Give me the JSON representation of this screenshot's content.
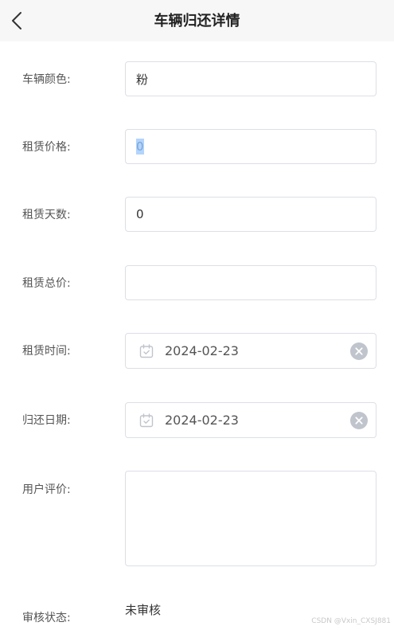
{
  "header": {
    "title": "车辆归还详情",
    "back_icon": "chevron-left-icon"
  },
  "form": {
    "color": {
      "label": "车辆颜色:",
      "value": "粉"
    },
    "price": {
      "label": "租赁价格:",
      "value": "0"
    },
    "days": {
      "label": "租赁天数:",
      "value": "0"
    },
    "total": {
      "label": "租赁总价:",
      "value": ""
    },
    "rent_time": {
      "label": "租赁时间:",
      "value": "2024-02-23",
      "icon": "calendar-icon",
      "clear_icon": "circle-close-icon"
    },
    "return_date": {
      "label": "归还日期:",
      "value": "2024-02-23",
      "icon": "calendar-icon",
      "clear_icon": "circle-close-icon"
    },
    "review": {
      "label": "用户评价:",
      "value": ""
    },
    "status": {
      "label": "审核状态:",
      "value": "未审核"
    }
  },
  "watermark": "CSDN @Vxin_CXSJ881",
  "colors": {
    "header_bg": "#f7f7f7",
    "border": "#dcdfe6",
    "selection": "#b3d4fc",
    "clear_icon": "#c0c4cc"
  }
}
